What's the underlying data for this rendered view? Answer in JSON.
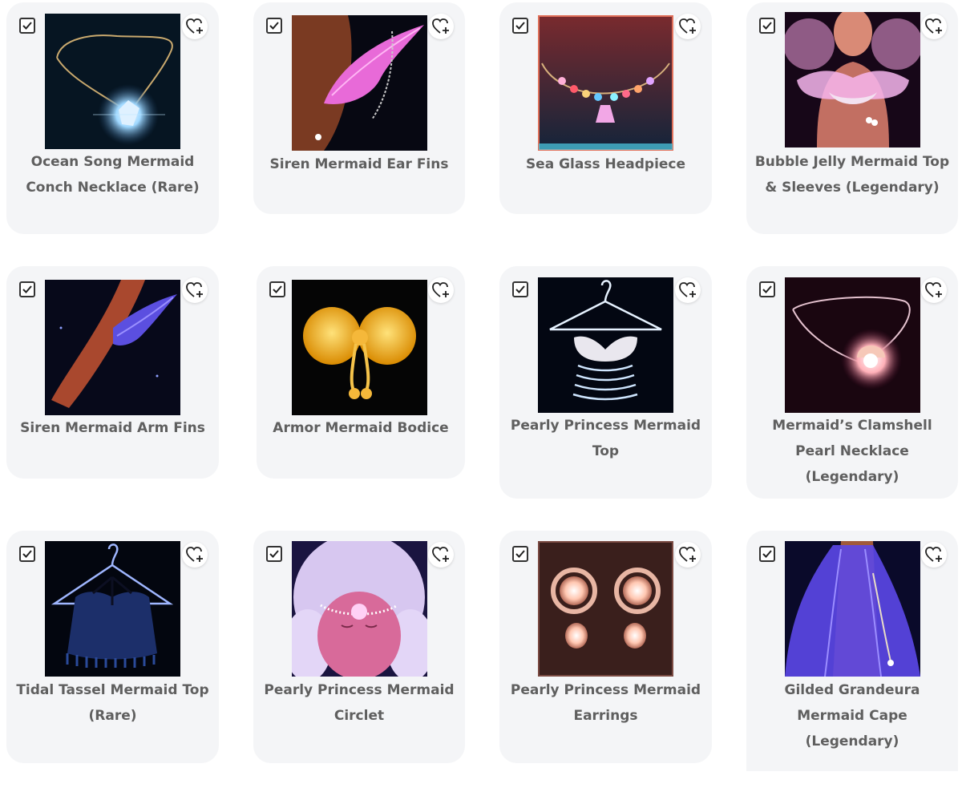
{
  "items": [
    {
      "title": "Ocean Song Mermaid Conch Necklace (Rare)",
      "checked": true,
      "icon": "conch-necklace-image"
    },
    {
      "title": "Siren Mermaid Ear Fins",
      "checked": true,
      "icon": "ear-fins-image"
    },
    {
      "title": "Sea Glass Headpiece",
      "checked": true,
      "icon": "sea-glass-necklace-image"
    },
    {
      "title": "Bubble Jelly Mermaid Top & Sleeves (Legendary)",
      "checked": true,
      "icon": "bubble-jelly-top-image"
    },
    {
      "title": "Siren Mermaid Arm Fins",
      "checked": true,
      "icon": "arm-fins-image"
    },
    {
      "title": "Armor Mermaid Bodice",
      "checked": true,
      "icon": "golden-bodice-image"
    },
    {
      "title": "Pearly Princess Mermaid Top",
      "checked": true,
      "icon": "pearl-top-on-hanger-image"
    },
    {
      "title": "Mermaid’s Clamshell Pearl Necklace (Legendary)",
      "checked": true,
      "icon": "clamshell-necklace-image"
    },
    {
      "title": "Tidal Tassel Mermaid Top (Rare)",
      "checked": true,
      "icon": "tassel-top-on-hanger-image"
    },
    {
      "title": "Pearly Princess Mermaid Circlet",
      "checked": true,
      "icon": "pearl-circlet-image"
    },
    {
      "title": "Pearly Princess Mermaid Earrings",
      "checked": true,
      "icon": "pearl-earrings-image"
    },
    {
      "title": "Gilded Grandeura Mermaid Cape (Legendary)",
      "checked": true,
      "icon": "mermaid-cape-image"
    }
  ],
  "icons": {
    "checkbox": "checkbox-checked-icon",
    "favorite": "heart-plus-icon"
  },
  "colors": {
    "card_background": "#f4f5f7",
    "title_text": "#5f5f5f",
    "page_background": "#ffffff"
  }
}
